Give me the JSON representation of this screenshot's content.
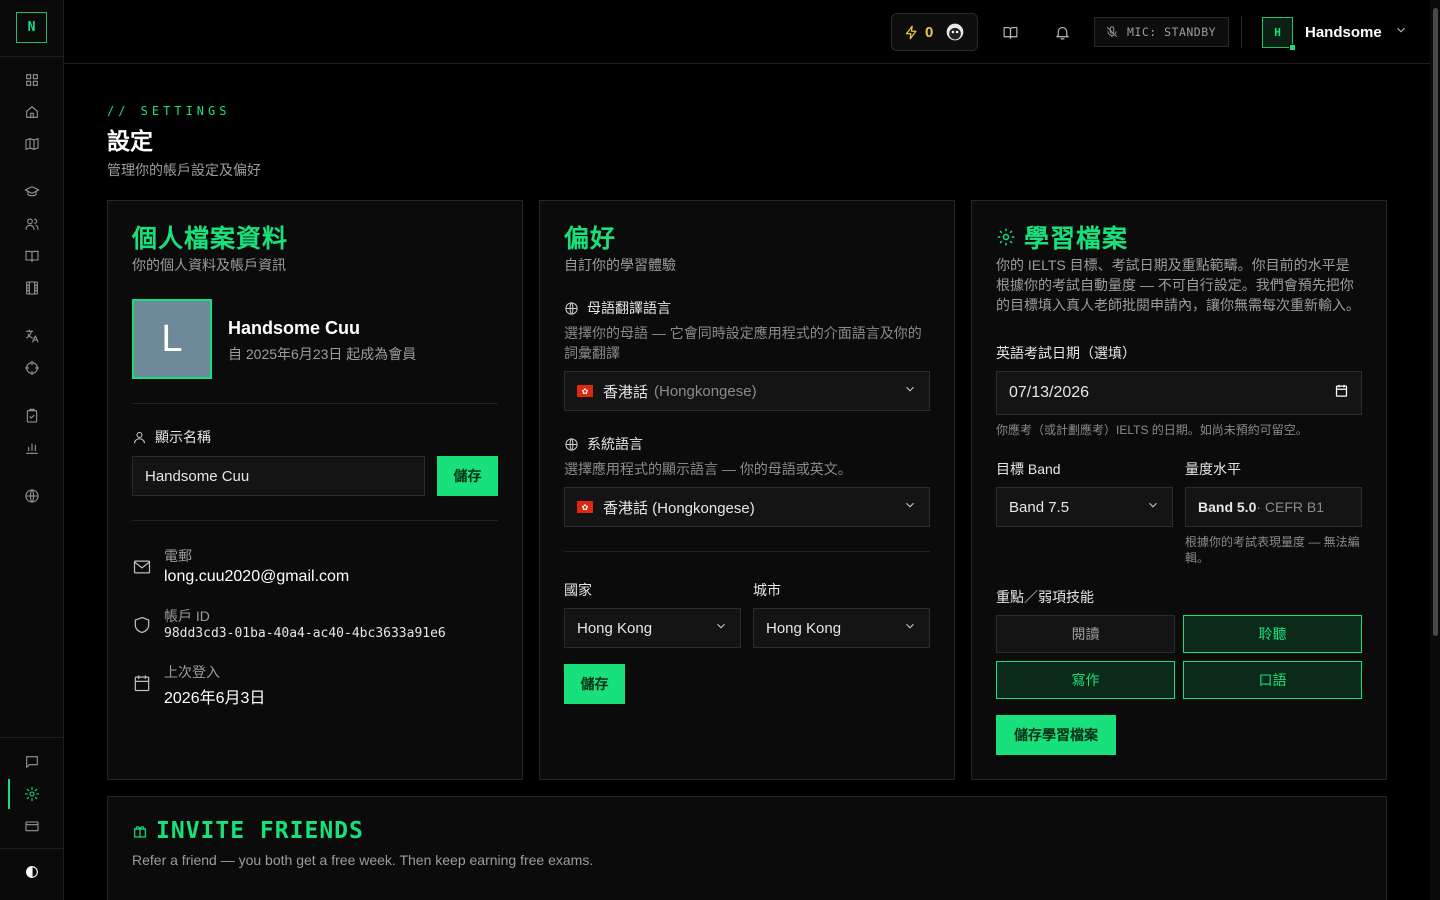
{
  "sidebar": {
    "logo": "N"
  },
  "topbar": {
    "energy_count": "0",
    "mic_status": "MIC: STANDBY",
    "user_initial": "H",
    "user_name": "Handsome"
  },
  "header": {
    "eyebrow": "// SETTINGS",
    "title": "設定",
    "subtitle": "管理你的帳戶設定及偏好"
  },
  "profile": {
    "title": "個人檔案資料",
    "subtitle": "你的個人資料及帳戶資訊",
    "avatar_initial": "L",
    "full_name": "Handsome Cuu",
    "member_since": "自 2025年6月23日 起成為會員",
    "display_name_label": "顯示名稱",
    "display_name_value": "Handsome Cuu",
    "save_label": "儲存",
    "email_label": "電郵",
    "email_value": "long.cuu2020@gmail.com",
    "account_id_label": "帳戶 ID",
    "account_id_value": "98dd3cd3-01ba-40a4-ac40-4bc3633a91e6",
    "last_login_label": "上次登入",
    "last_login_value": "2026年6月3日"
  },
  "preferences": {
    "title": "偏好",
    "subtitle": "自訂你的學習體驗",
    "native_lang_label": "母語翻譯語言",
    "native_lang_hint": "選擇你的母語 — 它會同時設定應用程式的介面語言及你的詞彙翻譯",
    "native_lang_value": "香港話",
    "native_lang_value_en": "(Hongkongese)",
    "system_lang_label": "系統語言",
    "system_lang_hint": "選擇應用程式的顯示語言 — 你的母語或英文。",
    "system_lang_value": "香港話 (Hongkongese)",
    "country_label": "國家",
    "country_value": "Hong Kong",
    "city_label": "城市",
    "city_value": "Hong Kong",
    "save_label": "儲存"
  },
  "learning": {
    "title": "學習檔案",
    "description": "你的 IELTS 目標、考試日期及重點範疇。你目前的水平是根據你的考試自動量度 — 不可自行設定。我們會預先把你的目標填入真人老師批閱申請內，讓你無需每次重新輸入。",
    "exam_date_label": "英語考試日期（選填）",
    "exam_date_value": "07/13/2026",
    "exam_date_hint": "你應考（或計劃應考）IELTS 的日期。如尚未預約可留空。",
    "target_band_label": "目標 Band",
    "target_band_value": "Band 7.5",
    "level_label": "量度水平",
    "level_value": "Band 5.0",
    "level_cefr": " · CEFR B1",
    "level_hint": "根據你的考試表現量度 — 無法編輯。",
    "focus_label": "重點／弱項技能",
    "skills": [
      {
        "label": "閱讀",
        "selected": false
      },
      {
        "label": "聆聽",
        "selected": true
      },
      {
        "label": "寫作",
        "selected": true
      },
      {
        "label": "口語",
        "selected": true
      }
    ],
    "save_label": "儲存學習檔案"
  },
  "invite": {
    "title": "INVITE FRIENDS",
    "subtitle": "Refer a friend — you both get a free week. Then keep earning free exams."
  },
  "colors": {
    "accent": "#18e07a",
    "background": "#000000",
    "card": "#0b0b0b",
    "energy": "#f5c542"
  }
}
